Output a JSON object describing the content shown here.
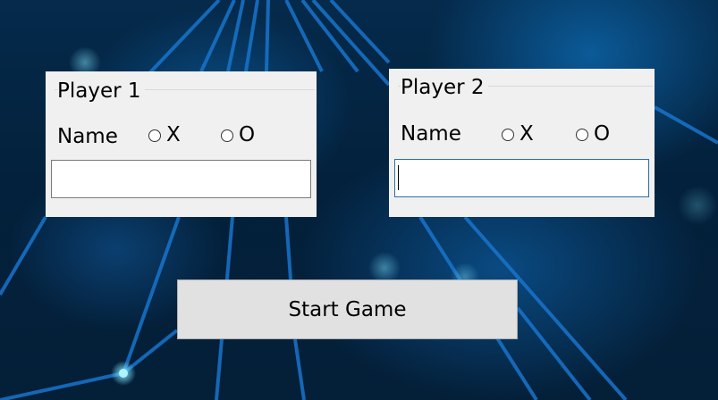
{
  "player1": {
    "title": "Player 1",
    "name_label": "Name",
    "option_x": "X",
    "option_o": "O",
    "name_value": ""
  },
  "player2": {
    "title": "Player 2",
    "name_label": "Name",
    "option_x": "X",
    "option_o": "O",
    "name_value": ""
  },
  "start_button_label": "Start Game",
  "colors": {
    "panel": "#f0f0f0",
    "button": "#e1e1e1",
    "background": "#04233f",
    "accent_lines": "#1a78d0",
    "focus_border": "#2b6ea8"
  }
}
